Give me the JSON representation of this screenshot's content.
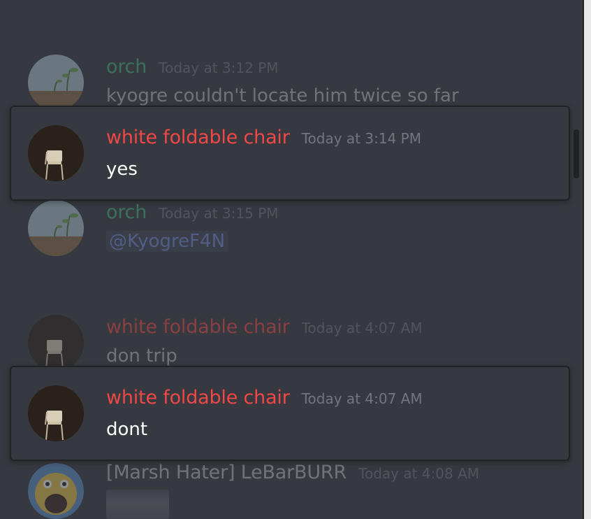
{
  "messages": [
    {
      "id": "m1",
      "author": "orch",
      "author_color": "#43b581",
      "timestamp": "Today at 3:12 PM",
      "text": "kyogre couldn't locate him twice so far",
      "dimmed": true
    },
    {
      "id": "m2",
      "author": "white foldable chair",
      "author_color": "#f04747",
      "timestamp": "Today at 3:14 PM",
      "text": "yes",
      "highlighted": true
    },
    {
      "id": "m3",
      "author": "orch",
      "author_color": "#43b581",
      "timestamp": "Today at 3:15 PM",
      "mention": "@KyogreF4N",
      "dimmed": true
    },
    {
      "id": "m4",
      "author": "white foldable chair",
      "author_color": "#f04747",
      "timestamp": "Today at 4:07 AM",
      "text": "don trip",
      "dimmed": true
    },
    {
      "id": "m5",
      "author": "white foldable chair",
      "author_color": "#f04747",
      "timestamp": "Today at 4:07 AM",
      "text": "dont",
      "highlighted": true
    },
    {
      "id": "m6",
      "author": "[Marsh Hater] LeBarBURR",
      "author_color": "#b9bbbe",
      "timestamp": "Today at 4:08 AM",
      "dimmed": true
    }
  ],
  "colors": {
    "background": "#36393f",
    "border": "#202225",
    "timestamp": "#72767d",
    "mention": "#7289da"
  },
  "icons": {
    "orch_avatar": "plant-seedling-avatar",
    "chair_avatar": "folding-chair-avatar",
    "marsh_avatar": "duck-avatar"
  }
}
